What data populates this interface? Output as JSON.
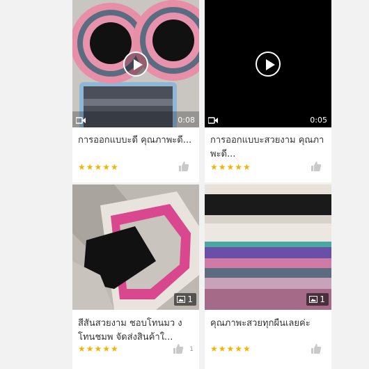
{
  "cards": [
    {
      "media": "video",
      "duration": "0:08",
      "title": "การออกแบบะดี คุณภาพะดี...",
      "rating": "★★★★★"
    },
    {
      "media": "video",
      "duration": "0:05",
      "title": "การออกแบบะสวยงาม คุณภาพะดี...",
      "rating": "★★★★★"
    },
    {
      "media": "images",
      "image_count": "1",
      "title": "สีสันสวยงาม ชอบโทนมว งโทนชมพ จัดส่งสินค้าใ...",
      "rating": "★★★★★",
      "like_count": "1"
    },
    {
      "media": "images",
      "image_count": "1",
      "title": "คุณภาพะสวยทุกผืนเลยค่ะ",
      "rating": "★★★★★"
    }
  ],
  "icons": {
    "play": "play-icon",
    "video": "video-camera-icon",
    "image": "image-icon",
    "like": "thumbs-up-icon",
    "star": "star-icon"
  },
  "colors": {
    "star": "#f5b301",
    "like": "#c9c9c9",
    "page_bg": "#f2f2f2"
  }
}
